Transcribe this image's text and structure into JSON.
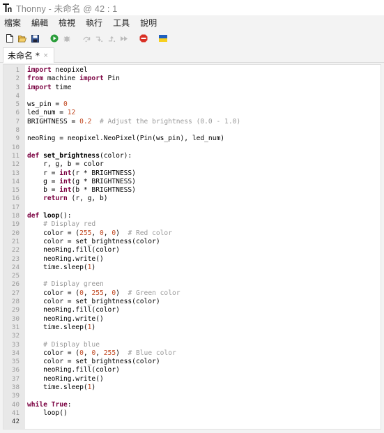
{
  "window": {
    "title": "Thonny  -  未命名  @  42 : 1"
  },
  "menu": [
    "檔案",
    "編輯",
    "檢視",
    "執行",
    "工具",
    "說明"
  ],
  "toolbar": [
    {
      "name": "new-file-icon"
    },
    {
      "name": "open-file-icon"
    },
    {
      "name": "save-file-icon"
    },
    {
      "name": "run-icon"
    },
    {
      "name": "debug-icon"
    },
    {
      "name": "step-over-icon"
    },
    {
      "name": "step-into-icon"
    },
    {
      "name": "step-out-icon"
    },
    {
      "name": "resume-icon"
    },
    {
      "name": "stop-icon"
    },
    {
      "name": "ukraine-flag-icon"
    }
  ],
  "colors": {
    "keyword": "#7a0040",
    "number": "#c0461e",
    "comment": "#9a9a9a",
    "gutter": "#e8e8e8",
    "run": "#2a9d3a",
    "stop": "#d93025"
  },
  "tab": {
    "label": "未命名 *",
    "close": "×"
  },
  "editor": {
    "current_line": 42,
    "lines": [
      [
        [
          "kw",
          "import"
        ],
        [
          "t",
          " neopixel"
        ]
      ],
      [
        [
          "kw",
          "from"
        ],
        [
          "t",
          " machine "
        ],
        [
          "kw",
          "import"
        ],
        [
          "t",
          " Pin"
        ]
      ],
      [
        [
          "kw",
          "import"
        ],
        [
          "t",
          " time"
        ]
      ],
      [],
      [
        [
          "t",
          "ws_pin = "
        ],
        [
          "num",
          "0"
        ]
      ],
      [
        [
          "t",
          "led_num = "
        ],
        [
          "num",
          "12"
        ]
      ],
      [
        [
          "t",
          "BRIGHTNESS = "
        ],
        [
          "num",
          "0.2"
        ],
        [
          "t",
          "  "
        ],
        [
          "cm",
          "# Adjust the brightness (0.0 - 1.0)"
        ]
      ],
      [],
      [
        [
          "t",
          "neoRing = neopixel.NeoPixel(Pin(ws_pin), led_num)"
        ]
      ],
      [],
      [
        [
          "kw",
          "def"
        ],
        [
          "t",
          " "
        ],
        [
          "fn",
          "set_brightness"
        ],
        [
          "t",
          "(color):"
        ]
      ],
      [
        [
          "t",
          "    r, g, b = color"
        ]
      ],
      [
        [
          "t",
          "    r = "
        ],
        [
          "kw2",
          "int"
        ],
        [
          "t",
          "(r * BRIGHTNESS)"
        ]
      ],
      [
        [
          "t",
          "    g = "
        ],
        [
          "kw2",
          "int"
        ],
        [
          "t",
          "(g * BRIGHTNESS)"
        ]
      ],
      [
        [
          "t",
          "    b = "
        ],
        [
          "kw2",
          "int"
        ],
        [
          "t",
          "(b * BRIGHTNESS)"
        ]
      ],
      [
        [
          "t",
          "    "
        ],
        [
          "kw",
          "return"
        ],
        [
          "t",
          " (r, g, b)"
        ]
      ],
      [],
      [
        [
          "kw",
          "def"
        ],
        [
          "t",
          " "
        ],
        [
          "fn",
          "loop"
        ],
        [
          "t",
          "():"
        ]
      ],
      [
        [
          "t",
          "    "
        ],
        [
          "cm",
          "# Display red"
        ]
      ],
      [
        [
          "t",
          "    color = ("
        ],
        [
          "num",
          "255"
        ],
        [
          "t",
          ", "
        ],
        [
          "num",
          "0"
        ],
        [
          "t",
          ", "
        ],
        [
          "num",
          "0"
        ],
        [
          "t",
          ")  "
        ],
        [
          "cm",
          "# Red color"
        ]
      ],
      [
        [
          "t",
          "    color = set_brightness(color)"
        ]
      ],
      [
        [
          "t",
          "    neoRing.fill(color)"
        ]
      ],
      [
        [
          "t",
          "    neoRing.write()"
        ]
      ],
      [
        [
          "t",
          "    time.sleep("
        ],
        [
          "num",
          "1"
        ],
        [
          "t",
          ")"
        ]
      ],
      [],
      [
        [
          "t",
          "    "
        ],
        [
          "cm",
          "# Display green"
        ]
      ],
      [
        [
          "t",
          "    color = ("
        ],
        [
          "num",
          "0"
        ],
        [
          "t",
          ", "
        ],
        [
          "num",
          "255"
        ],
        [
          "t",
          ", "
        ],
        [
          "num",
          "0"
        ],
        [
          "t",
          ")  "
        ],
        [
          "cm",
          "# Green color"
        ]
      ],
      [
        [
          "t",
          "    color = set_brightness(color)"
        ]
      ],
      [
        [
          "t",
          "    neoRing.fill(color)"
        ]
      ],
      [
        [
          "t",
          "    neoRing.write()"
        ]
      ],
      [
        [
          "t",
          "    time.sleep("
        ],
        [
          "num",
          "1"
        ],
        [
          "t",
          ")"
        ]
      ],
      [],
      [
        [
          "t",
          "    "
        ],
        [
          "cm",
          "# Display blue"
        ]
      ],
      [
        [
          "t",
          "    color = ("
        ],
        [
          "num",
          "0"
        ],
        [
          "t",
          ", "
        ],
        [
          "num",
          "0"
        ],
        [
          "t",
          ", "
        ],
        [
          "num",
          "255"
        ],
        [
          "t",
          ")  "
        ],
        [
          "cm",
          "# Blue color"
        ]
      ],
      [
        [
          "t",
          "    color = set_brightness(color)"
        ]
      ],
      [
        [
          "t",
          "    neoRing.fill(color)"
        ]
      ],
      [
        [
          "t",
          "    neoRing.write()"
        ]
      ],
      [
        [
          "t",
          "    time.sleep("
        ],
        [
          "num",
          "1"
        ],
        [
          "t",
          ")"
        ]
      ],
      [],
      [
        [
          "kw",
          "while"
        ],
        [
          "t",
          " "
        ],
        [
          "kw",
          "True"
        ],
        [
          "t",
          ":"
        ]
      ],
      [
        [
          "t",
          "    loop()"
        ]
      ],
      []
    ]
  }
}
